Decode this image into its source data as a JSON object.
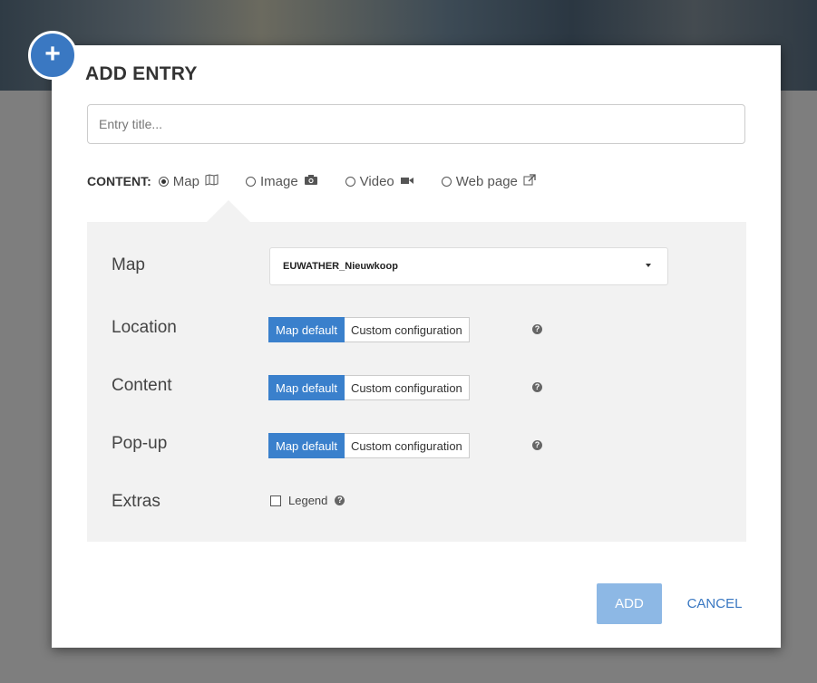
{
  "dialog": {
    "title": "ADD ENTRY",
    "title_placeholder": "Entry title...",
    "content_label": "CONTENT:",
    "content_options": [
      {
        "label": "Map",
        "icon": "map-icon",
        "selected": true
      },
      {
        "label": "Image",
        "icon": "camera-icon",
        "selected": false
      },
      {
        "label": "Video",
        "icon": "video-icon",
        "selected": false
      },
      {
        "label": "Web page",
        "icon": "external-link-icon",
        "selected": false
      }
    ],
    "plus_icon": "+"
  },
  "panel": {
    "map_label": "Map",
    "map_value": "EUWATHER_Nieuwkoop",
    "location_label": "Location",
    "content_label": "Content",
    "popup_label": "Pop-up",
    "extras_label": "Extras",
    "default_option": "Map default",
    "custom_option": "Custom configuration",
    "legend_label": "Legend",
    "legend_checked": false
  },
  "buttons": {
    "add": "ADD",
    "cancel": "CANCEL"
  },
  "colors": {
    "accent": "#3a80cc",
    "add_disabled": "#8db8e5",
    "panel_bg": "#f2f2f2"
  }
}
